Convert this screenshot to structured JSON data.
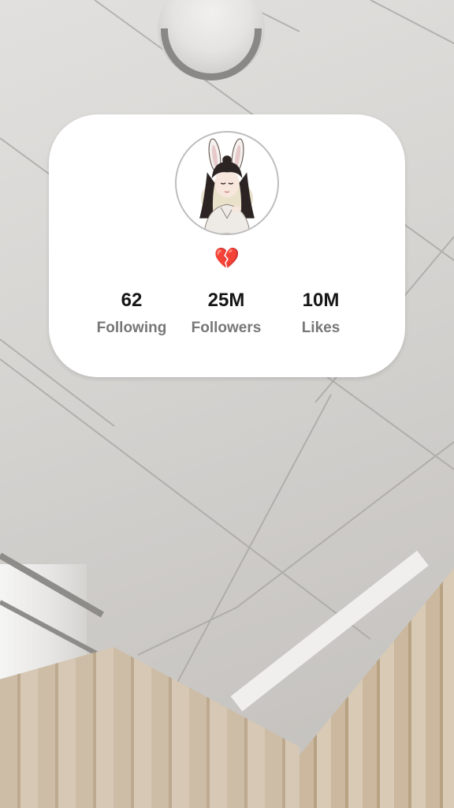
{
  "profile": {
    "avatar_icon": "anime-bunny-girl-avatar",
    "bio": "💔",
    "stats": [
      {
        "value": "62",
        "label": "Following"
      },
      {
        "value": "25M",
        "label": "Followers"
      },
      {
        "value": "10M",
        "label": "Likes"
      }
    ]
  },
  "colors": {
    "card": "#ffffff",
    "stat_value": "#161616",
    "stat_label": "#777777"
  }
}
